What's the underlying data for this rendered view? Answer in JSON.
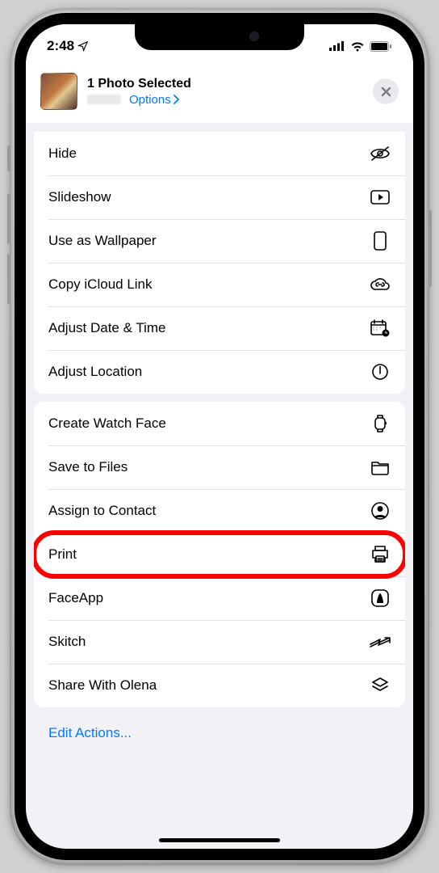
{
  "status": {
    "time": "2:48",
    "location_glyph": "➤"
  },
  "header": {
    "title": "1 Photo Selected",
    "options_label": "Options"
  },
  "group1": [
    {
      "label": "Hide",
      "icon": "eye-slash"
    },
    {
      "label": "Slideshow",
      "icon": "play-rect"
    },
    {
      "label": "Use as Wallpaper",
      "icon": "phone"
    },
    {
      "label": "Copy iCloud Link",
      "icon": "cloud-link"
    },
    {
      "label": "Adjust Date & Time",
      "icon": "calendar-clock"
    },
    {
      "label": "Adjust Location",
      "icon": "info-pin"
    }
  ],
  "group2": [
    {
      "label": "Create Watch Face",
      "icon": "watch"
    },
    {
      "label": "Save to Files",
      "icon": "folder"
    },
    {
      "label": "Assign to Contact",
      "icon": "contact"
    },
    {
      "label": "Print",
      "icon": "printer",
      "highlight": true
    },
    {
      "label": "FaceApp",
      "icon": "faceapp"
    },
    {
      "label": "Skitch",
      "icon": "skitch"
    },
    {
      "label": "Share With Olena",
      "icon": "share-stack"
    }
  ],
  "edit_actions_label": "Edit Actions..."
}
